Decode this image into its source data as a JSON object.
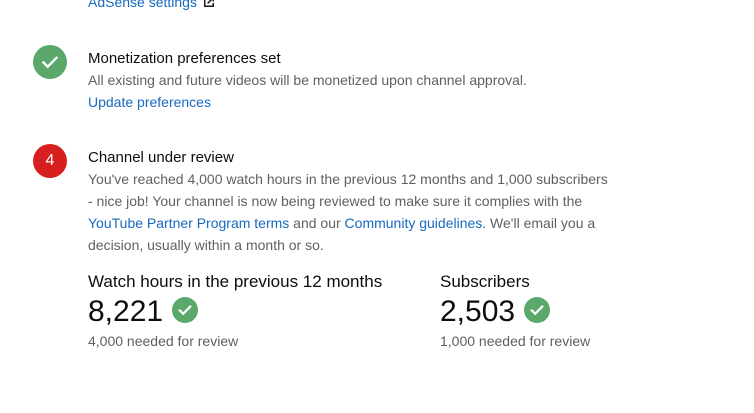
{
  "adsense": {
    "link_label": "AdSense settings",
    "icon": "external-link-icon"
  },
  "steps": [
    {
      "status": "done",
      "icon": "check-icon",
      "title": "Monetization preferences set",
      "description": "All existing and future videos will be monetized upon channel approval.",
      "link_label": "Update preferences"
    },
    {
      "status": "current",
      "number": "4",
      "title": "Channel under review",
      "description_parts": {
        "p1": "You've reached 4,000 watch hours in the previous 12 months and 1,000 subscribers - nice job! Your channel is now being reviewed to make sure it complies with the ",
        "link1": "YouTube Partner Program terms",
        "p2": " and our ",
        "link2": "Community guidelines",
        "p3": ". We'll email you a decision, usually within a month or so."
      }
    }
  ],
  "stats": [
    {
      "label": "Watch hours in the previous 12 months",
      "value": "8,221",
      "met": true,
      "note": "4,000 needed for review"
    },
    {
      "label": "Subscribers",
      "value": "2,503",
      "met": true,
      "note": "1,000 needed for review"
    }
  ],
  "colors": {
    "success": "#5aa86c",
    "step_number_badge": "#d71f1f",
    "link": "#1769c1",
    "secondary_text": "#606060"
  }
}
